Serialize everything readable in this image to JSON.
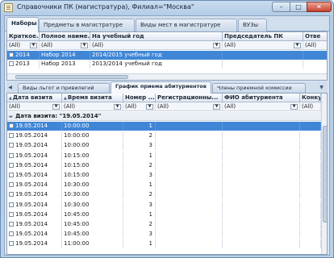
{
  "window": {
    "title": "Справочники ПК (магистратура), Филиал=\"Москва\"",
    "controls": {
      "minimize": "–",
      "maximize": "□",
      "close": "✕"
    }
  },
  "top_tabs": [
    "Наборы",
    "Предметы в магистратуре",
    "Виды мест в магистратуре",
    "ВУЗы"
  ],
  "top_active_tab": "Наборы",
  "top_grid": {
    "columns": [
      "Краткое...",
      "Полное наиме...",
      "На учебный год",
      "Председатель ПК",
      "Отве"
    ],
    "filter_value": "(All)",
    "rows": [
      {
        "short": "2014",
        "full": "Набор 2014",
        "year": "2014/2015 учебный год",
        "chair": "",
        "resp": ""
      },
      {
        "short": "2013",
        "full": "Набор 2013",
        "year": "2013/2014 учебный год",
        "chair": "",
        "resp": ""
      }
    ]
  },
  "bottom_tabs": [
    "Виды льгот и привилегий",
    "График приема абитуриентов",
    "Члены приемной комиссии"
  ],
  "bottom_active_tab": "График приема абитуриентов",
  "bottom_grid": {
    "columns": [
      "Дата визита",
      "Время визита",
      "Номер ...",
      "Регистрационны...",
      "ФИО абитуриента",
      "Конкурс"
    ],
    "filter_value": "(All)",
    "group_label": "Дата визита: \"19.05.2014\"",
    "rows": [
      {
        "date": "19.05.2014",
        "time": "10:00:00",
        "num": "1"
      },
      {
        "date": "19.05.2014",
        "time": "10:00:00",
        "num": "2"
      },
      {
        "date": "19.05.2014",
        "time": "10:00:00",
        "num": "3"
      },
      {
        "date": "19.05.2014",
        "time": "10:15:00",
        "num": "1"
      },
      {
        "date": "19.05.2014",
        "time": "10:15:00",
        "num": "2"
      },
      {
        "date": "19.05.2014",
        "time": "10:15:00",
        "num": "3"
      },
      {
        "date": "19.05.2014",
        "time": "10:30:00",
        "num": "1"
      },
      {
        "date": "19.05.2014",
        "time": "10:30:00",
        "num": "2"
      },
      {
        "date": "19.05.2014",
        "time": "10:30:00",
        "num": "3"
      },
      {
        "date": "19.05.2014",
        "time": "10:45:00",
        "num": "1"
      },
      {
        "date": "19.05.2014",
        "time": "10:45:00",
        "num": "2"
      },
      {
        "date": "19.05.2014",
        "time": "10:45:00",
        "num": "3"
      },
      {
        "date": "19.05.2014",
        "time": "11:00:00",
        "num": "1"
      }
    ]
  }
}
